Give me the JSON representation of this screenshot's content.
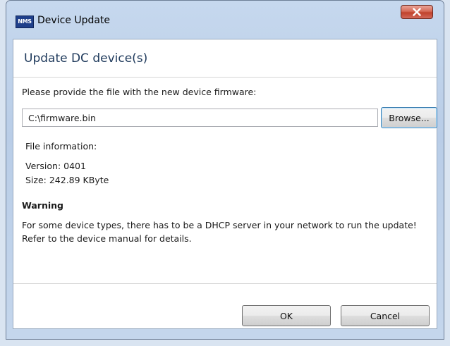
{
  "window": {
    "app_icon_text": "NMS",
    "title": "Device Update"
  },
  "icons": {
    "app": "nms-app-icon",
    "close": "close-icon"
  },
  "dialog": {
    "heading": "Update DC device(s)",
    "prompt": "Please provide the file with the new device firmware:",
    "file_path": "C:\\firmware.bin",
    "browse_label": "Browse...",
    "file_info_label": "File information:",
    "version_line": "Version: 0401",
    "size_line": "Size: 242.89 KByte",
    "warning_title": "Warning",
    "warning_message": "For some device types, there has to be a DHCP server in your network to run the update! Refer to the device manual for details."
  },
  "buttons": {
    "ok": "OK",
    "cancel": "Cancel"
  },
  "colors": {
    "heading": "#1e395b",
    "close_button": "#c0422c",
    "focus_border": "#3c7fb1"
  }
}
